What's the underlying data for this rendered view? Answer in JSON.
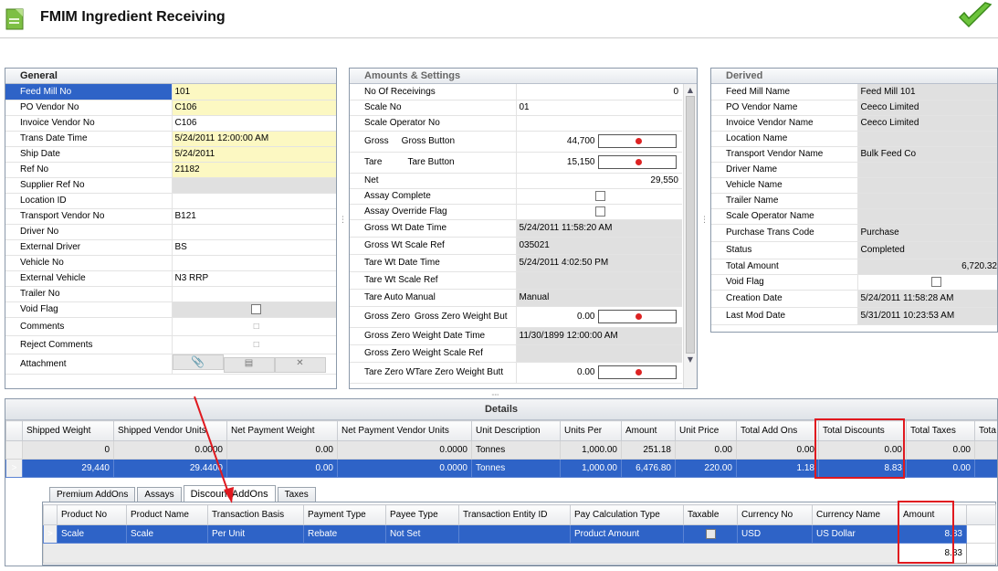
{
  "app": {
    "title": "FMIM Ingredient Receiving"
  },
  "general": {
    "title": "General",
    "rows": [
      {
        "label": "Feed Mill No",
        "value": "101"
      },
      {
        "label": "PO Vendor No",
        "value": "C106"
      },
      {
        "label": "Invoice Vendor No",
        "value": "C106"
      },
      {
        "label": "Trans Date Time",
        "value": "5/24/2011 12:00:00 AM"
      },
      {
        "label": "Ship Date",
        "value": "5/24/2011"
      },
      {
        "label": "Ref No",
        "value": "21182"
      },
      {
        "label": "Supplier Ref No",
        "value": ""
      },
      {
        "label": "Location ID",
        "value": ""
      },
      {
        "label": "Transport Vendor No",
        "value": "B121"
      },
      {
        "label": "Driver No",
        "value": ""
      },
      {
        "label": "External Driver",
        "value": "BS"
      },
      {
        "label": "Vehicle No",
        "value": ""
      },
      {
        "label": "External Vehicle",
        "value": "N3 RRP"
      },
      {
        "label": "Trailer No",
        "value": ""
      },
      {
        "label": "Void Flag",
        "value": ""
      },
      {
        "label": "Comments",
        "value": ""
      },
      {
        "label": "Reject Comments",
        "value": ""
      },
      {
        "label": "Attachment",
        "value": ""
      }
    ]
  },
  "amounts": {
    "title": "Amounts & Settings",
    "rows": [
      {
        "label": "No Of Receivings",
        "value": "0"
      },
      {
        "label": "Scale No",
        "value": "01"
      },
      {
        "label": "Scale Operator No",
        "value": ""
      },
      {
        "label": "Gross",
        "sublabel": "Gross Button",
        "value": "44,700"
      },
      {
        "label": "Tare",
        "sublabel": "Tare Button",
        "value": "15,150"
      },
      {
        "label": "Net",
        "value": "29,550"
      },
      {
        "label": "Assay Complete",
        "value": ""
      },
      {
        "label": "Assay Override Flag",
        "value": ""
      },
      {
        "label": "Gross Wt Date Time",
        "value": "5/24/2011 11:58:20 AM"
      },
      {
        "label": "Gross Wt Scale Ref",
        "value": "035021"
      },
      {
        "label": "Tare Wt Date Time",
        "value": "5/24/2011 4:02:50 PM"
      },
      {
        "label": "Tare Wt Scale Ref",
        "value": ""
      },
      {
        "label": "Tare Auto Manual",
        "value": "Manual"
      },
      {
        "label": "Gross Zero",
        "sublabel": "Gross Zero Weight But",
        "value": "0.00"
      },
      {
        "label": "Gross Zero Weight Date Time",
        "value": "11/30/1899 12:00:00 AM"
      },
      {
        "label": "Gross Zero Weight Scale Ref",
        "value": ""
      },
      {
        "label": "Tare Zero W",
        "sublabel": "Tare Zero Weight Butt",
        "value": "0.00"
      }
    ]
  },
  "derived": {
    "title": "Derived",
    "rows": [
      {
        "label": "Feed Mill Name",
        "value": "Feed Mill 101"
      },
      {
        "label": "PO Vendor Name",
        "value": "Ceeco Limited"
      },
      {
        "label": "Invoice Vendor Name",
        "value": "Ceeco Limited"
      },
      {
        "label": "Location Name",
        "value": ""
      },
      {
        "label": "Transport Vendor Name",
        "value": "Bulk Feed Co"
      },
      {
        "label": "Driver Name",
        "value": ""
      },
      {
        "label": "Vehicle Name",
        "value": ""
      },
      {
        "label": "Trailer Name",
        "value": ""
      },
      {
        "label": "Scale Operator Name",
        "value": ""
      },
      {
        "label": "Purchase Trans Code",
        "value": "Purchase"
      },
      {
        "label": "Status",
        "value": "Completed"
      },
      {
        "label": "Total Amount",
        "value": "6,720.32"
      },
      {
        "label": "Void Flag",
        "value": ""
      },
      {
        "label": "Creation Date",
        "value": "5/24/2011 11:58:28 AM"
      },
      {
        "label": "Last Mod Date",
        "value": "5/31/2011 10:23:53 AM"
      }
    ]
  },
  "details": {
    "title": "Details",
    "columns": [
      "Shipped Weight",
      "Shipped Vendor Units",
      "Net Payment Weight",
      "Net Payment Vendor Units",
      "Unit Description",
      "Units Per",
      "Amount",
      "Unit Price",
      "Total Add Ons",
      "Total Discounts",
      "Total Taxes",
      "Tota"
    ],
    "rows": [
      [
        "0",
        "0.0000",
        "0.00",
        "0.0000",
        "Tonnes",
        "1,000.00",
        "251.18",
        "0.00",
        "0.00",
        "0.00",
        "0.00",
        ""
      ],
      [
        "29,440",
        "29.4400",
        "0.00",
        "0.0000",
        "Tonnes",
        "1,000.00",
        "6,476.80",
        "220.00",
        "1.18",
        "8.83",
        "0.00",
        ""
      ]
    ],
    "selected_indicator": ">"
  },
  "tabs": [
    "Premium AddOns",
    "Assays",
    "Discount AddOns",
    "Taxes"
  ],
  "discount": {
    "columns": [
      "Product No",
      "Product Name",
      "Transaction Basis",
      "Payment Type",
      "Payee Type",
      "Transaction Entity ID",
      "Pay Calculation Type",
      "Taxable",
      "Currency No",
      "Currency Name",
      "Amount"
    ],
    "row": [
      "Scale",
      "Scale",
      "Per Unit",
      "Rebate",
      "Not Set",
      "",
      "Product Amount",
      "",
      "USD",
      "US Dollar",
      "8.83"
    ],
    "total": "8.83",
    "selected_indicator": ">"
  },
  "colors": {
    "selection": "#2e63c7",
    "required": "#fcf8c2",
    "readonly": "#e0e0e0",
    "annotation": "#e0191f"
  }
}
